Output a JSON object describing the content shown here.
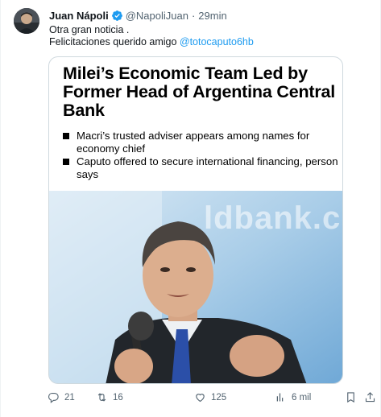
{
  "tweet": {
    "author_name": "Juan Nápoli",
    "author_handle": "@NapoliJuan",
    "separator": "·",
    "time": "29min",
    "line1": "Otra gran noticia .",
    "line2_prefix": "Felicitaciones querido amigo ",
    "mention": "@totocaputo6hb",
    "accent": "#1d9bf0"
  },
  "card": {
    "title": "Milei’s Economic Team Led by Former Head of Argentina Central Bank",
    "bullets": [
      "Macri’s trusted adviser appears among names for economy chief",
      "Caputo offered to secure international financing, person says"
    ],
    "photo_watermark": "ldbank.c"
  },
  "actions": {
    "replies": "21",
    "retweets": "16",
    "likes": "125",
    "views": "6 mil",
    "icons": [
      "reply-icon",
      "retweet-icon",
      "like-icon",
      "views-icon",
      "bookmark-icon",
      "share-icon"
    ]
  }
}
